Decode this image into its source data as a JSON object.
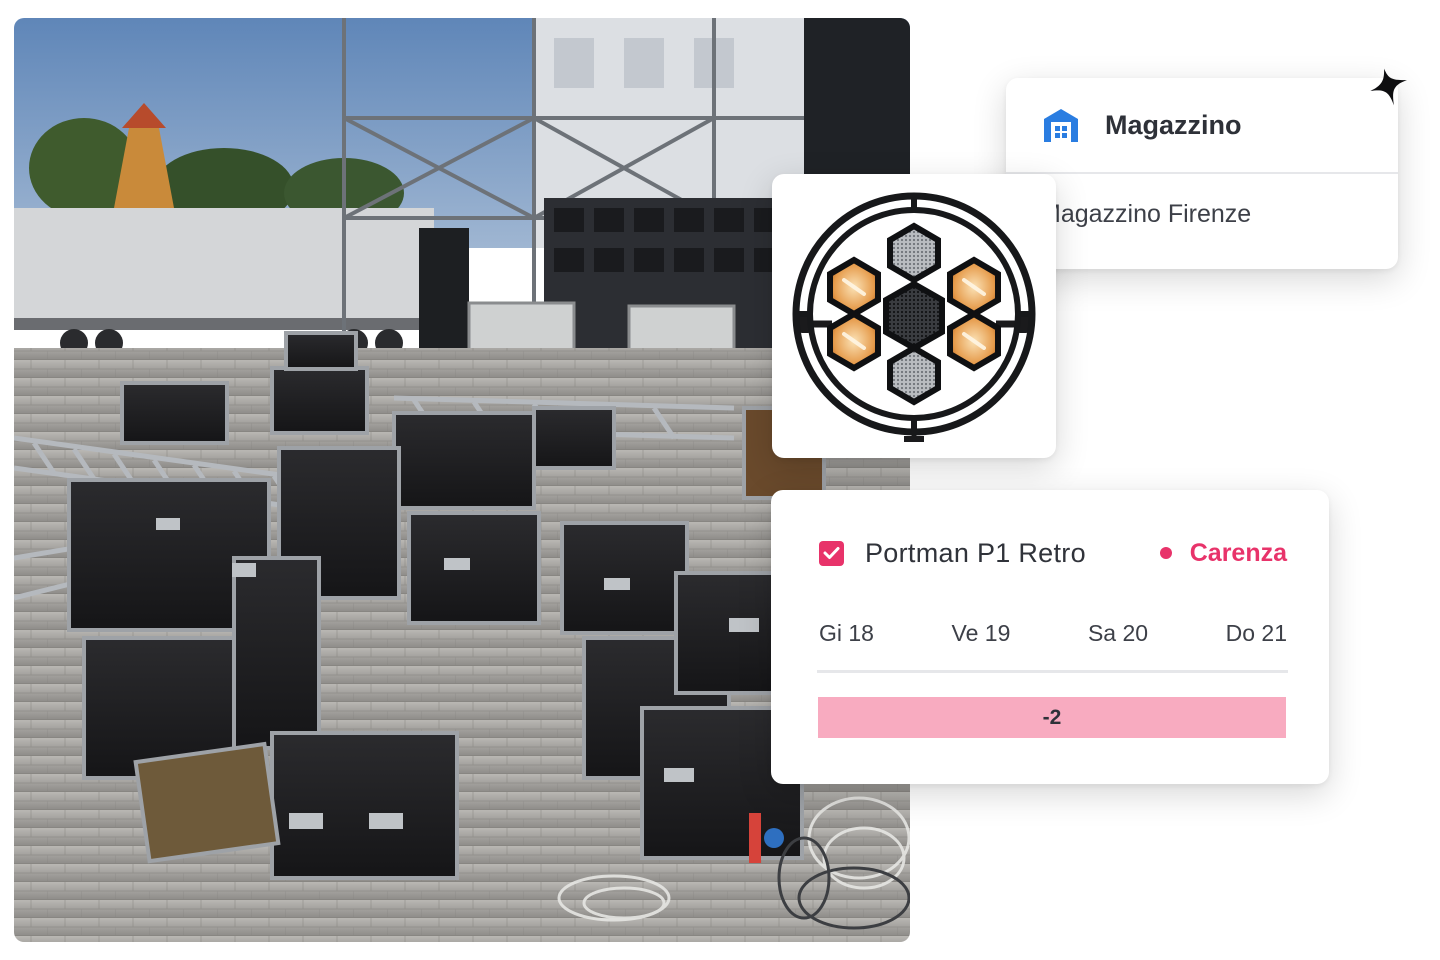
{
  "warehouse": {
    "icon": "warehouse-icon",
    "title": "Magazzino",
    "value": "Magazzino Firenze"
  },
  "product": {
    "image_icon": "stage-light-icon",
    "name": "Portman P1 Retro",
    "checked": true,
    "status": "Carenza",
    "days": [
      "Gi 18",
      "Ve 19",
      "Sa 20",
      "Do 21"
    ],
    "shortage": "-2"
  },
  "colors": {
    "accent": "#e8336a",
    "shortage_fill": "#f8abc0",
    "icon_blue": "#2a7de1"
  }
}
